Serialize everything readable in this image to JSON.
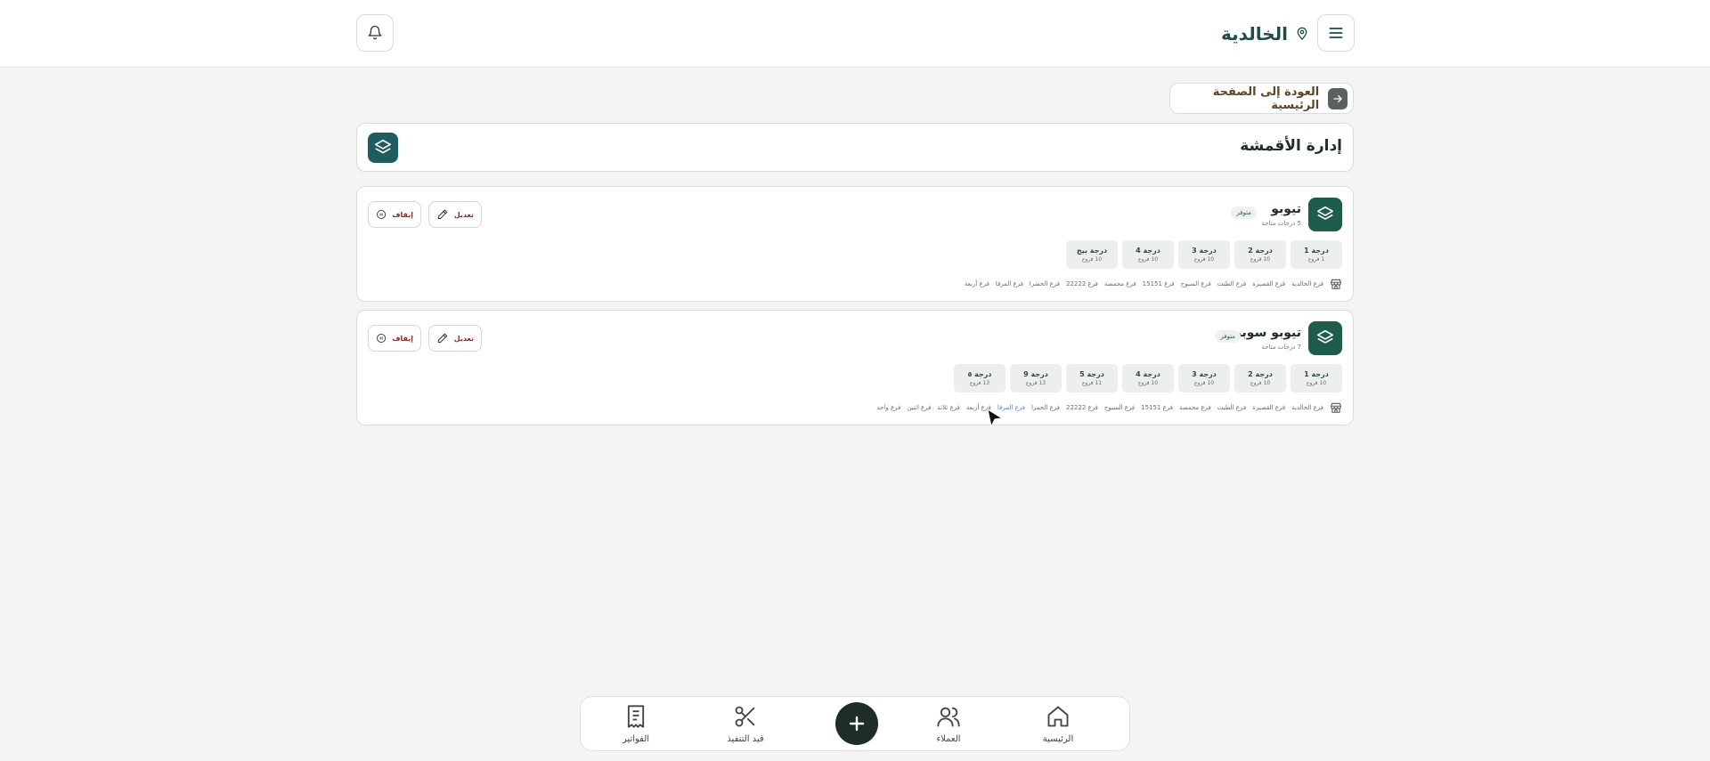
{
  "header": {
    "location_name": "الخالدية",
    "menu_icon": "menu-icon",
    "location_icon": "map-pin-icon",
    "bell_icon": "bell-icon"
  },
  "back_button": {
    "label": "العودة إلى الصفحة الرئيسية"
  },
  "page": {
    "title": "إدارة الأقمشة"
  },
  "fabrics": [
    {
      "name": "تيوبو",
      "subtitle": "5 درجات متاحة",
      "badge": "متوفر",
      "edit_label": "تعديل",
      "stop_label": "إيقاف",
      "grades": [
        {
          "name": "درجة 1",
          "count": "1 فروع"
        },
        {
          "name": "درجة 2",
          "count": "10 فروع"
        },
        {
          "name": "درجة 3",
          "count": "10 فروع"
        },
        {
          "name": "درجة 4",
          "count": "10 فروع"
        },
        {
          "name": "درجة بيج",
          "count": "10 فروع"
        }
      ],
      "branches": [
        "فرع الخالدية",
        "فرع القصيرة",
        "فرع الطبث",
        "فرع السبوح",
        "فرع 15151",
        "فرع محمصة",
        "فرع 22222",
        "فرع الخضرا",
        "فرع المرقا",
        "فرع أربعة"
      ]
    },
    {
      "name": "تيوبو سوبر",
      "subtitle": "7 درجات متاحة",
      "badge": "متوفر",
      "edit_label": "تعديل",
      "stop_label": "إيقاف",
      "grades": [
        {
          "name": "درجة 1",
          "count": "10 فروع"
        },
        {
          "name": "درجة 2",
          "count": "10 فروع"
        },
        {
          "name": "درجة 3",
          "count": "10 فروع"
        },
        {
          "name": "درجة 4",
          "count": "10 فروع"
        },
        {
          "name": "درجة 5",
          "count": "11 فروع"
        },
        {
          "name": "درجة 9",
          "count": "13 فروع"
        },
        {
          "name": "درجة ٥",
          "count": "13 فروع"
        }
      ],
      "branches": [
        "فرع الخالدية",
        "فرع القصيرة",
        "فرع الطبث",
        "فرع محمصة",
        "فرع 15151",
        "فرع السبوح",
        "فرع 22222",
        "فرع الحمرا",
        "فرع المرقا",
        "فرع أربعة",
        "فرع ثلاثة",
        "فرع اثنين",
        "فرع واحد"
      ]
    }
  ],
  "bottom_nav": {
    "home": "الرئيسية",
    "customers": "العملاء",
    "in_progress": "قيد التنفيذ",
    "invoices": "الفواتير"
  }
}
